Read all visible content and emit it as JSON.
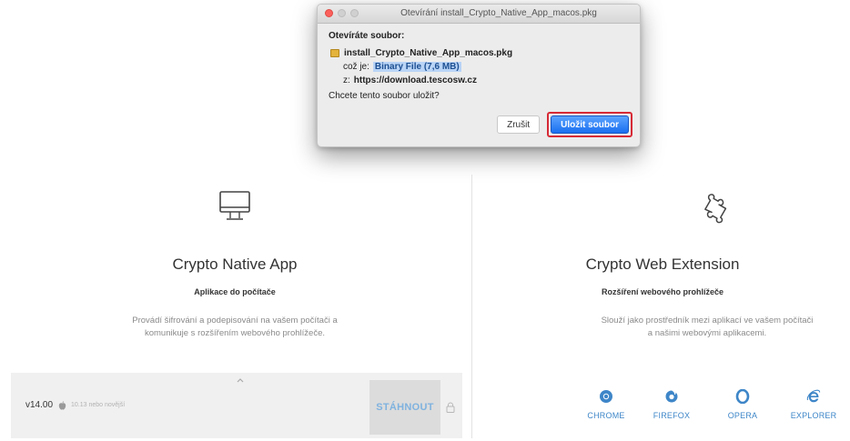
{
  "dialog": {
    "title": "Otevírání install_Crypto_Native_App_macos.pkg",
    "heading": "Otevíráte soubor:",
    "filename": "install_Crypto_Native_App_macos.pkg",
    "type_label": "což je:",
    "type_value": "Binary File (7,6 MB)",
    "from_label": "z:",
    "from_value": "https://download.tescosw.cz",
    "question": "Chcete tento soubor uložit?",
    "cancel_label": "Zrušit",
    "save_label": "Uložit soubor",
    "highlight_color": "#d72a35"
  },
  "left_panel": {
    "icon": "monitor-icon",
    "title": "Crypto Native App",
    "subtitle": "Aplikace do počítače",
    "description": "Provádí šifrování a podepisování na vašem počítači a komunikuje s rozšířením webového prohlížeče.",
    "download": {
      "version": "v14.00",
      "os_icon": "apple-icon",
      "os_text": "10.13 nebo novější",
      "button_label": "STÁHNOUT",
      "lock_icon": "lock-icon"
    }
  },
  "right_panel": {
    "icon": "puzzle-icon",
    "title": "Crypto Web Extension",
    "subtitle": "Rozšíření webového prohlížeče",
    "description": "Slouží jako prostředník mezi aplikací ve vašem počítači a našimi webovými aplikacemi.",
    "browsers": [
      {
        "icon": "chrome-icon",
        "label": "CHROME"
      },
      {
        "icon": "firefox-icon",
        "label": "FIREFOX"
      },
      {
        "icon": "opera-icon",
        "label": "OPERA"
      },
      {
        "icon": "explorer-icon",
        "label": "EXPLORER"
      }
    ],
    "accent_color": "#3e86c8"
  }
}
